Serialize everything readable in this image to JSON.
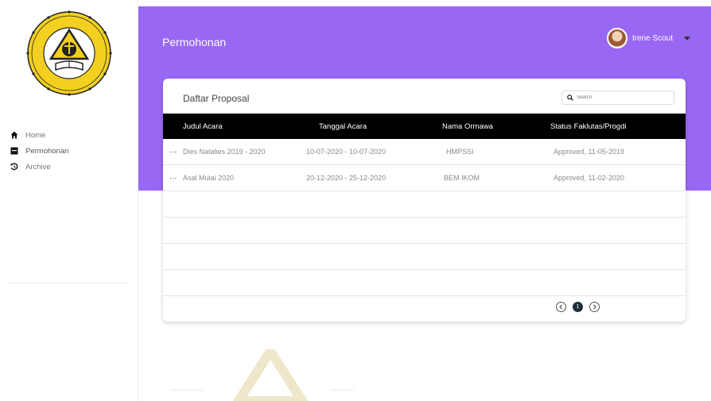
{
  "header": {
    "title": "Permohonan"
  },
  "user": {
    "name": "Irene Scout"
  },
  "sidebar": {
    "items": [
      {
        "label": "Home",
        "icon": "home-icon"
      },
      {
        "label": "Permohonan",
        "icon": "inbox-icon"
      },
      {
        "label": "Archive",
        "icon": "history-icon"
      }
    ]
  },
  "card": {
    "title": "Daftar Proposal",
    "search_placeholder": "Search"
  },
  "table": {
    "columns": [
      "Judul Acara",
      "Tanggal Acara",
      "Nama Ormawa",
      "Status Faklutas/Progdi"
    ],
    "rows": [
      {
        "title": "Dies Natalies 2019 - 2020",
        "date": "10-07-2020 - 10-07-2020",
        "org": "HMPSSI",
        "status": "Approved, 11-05-2019"
      },
      {
        "title": "Asal Mulai 2020",
        "date": "20-12-2020 - 25-12-2020",
        "org": "BEM IKOM",
        "status": "Approved, 11-02-2020"
      }
    ],
    "actions_label": "..."
  },
  "pagination": {
    "current": "1"
  },
  "colors": {
    "header": "#9968f3",
    "table_head": "#000000",
    "logo_gold": "#f3d020"
  }
}
